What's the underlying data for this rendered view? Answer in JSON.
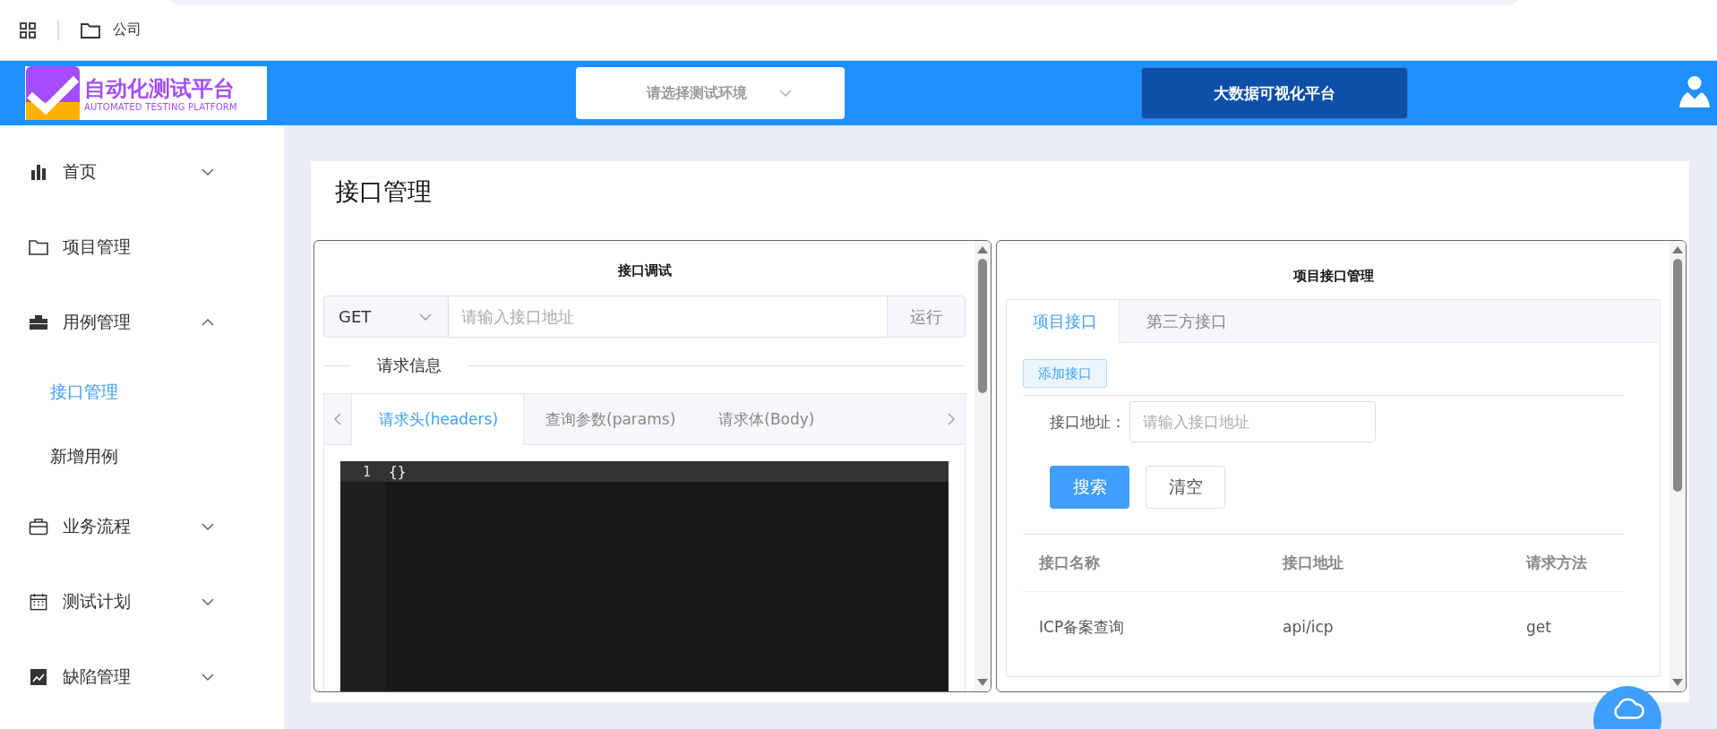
{
  "browser_bar": {
    "breadcrumb": "公司"
  },
  "header": {
    "logo_title": "自动化测试平台",
    "logo_subtitle": "AUTOMATED TESTING PLATFORM",
    "env_select": {
      "placeholder": "请选择测试环境"
    },
    "dashboard_button": "大数据可视化平台"
  },
  "sidebar": {
    "items": [
      {
        "label": "首页",
        "expanded": false
      },
      {
        "label": "项目管理"
      },
      {
        "label": "用例管理",
        "expanded": true,
        "children": [
          {
            "label": "接口管理",
            "selected": true
          },
          {
            "label": "新增用例",
            "selected": false
          }
        ]
      },
      {
        "label": "业务流程",
        "expanded": false
      },
      {
        "label": "测试计划",
        "expanded": false
      },
      {
        "label": "缺陷管理",
        "expanded": false
      }
    ]
  },
  "page_title": "接口管理",
  "debug_panel": {
    "title": "接口调试",
    "method": "GET",
    "url_field": {
      "placeholder": "请输入接口地址"
    },
    "run_button": "运行",
    "section_title": "请求信息",
    "tabs": [
      {
        "label": "请求头(headers)",
        "selected": true
      },
      {
        "label": "查询参数(params)",
        "selected": false
      },
      {
        "label": "请求体(Body)",
        "selected": false
      }
    ],
    "editor": {
      "lines": [
        {
          "number": "1",
          "text": "{}"
        }
      ]
    }
  },
  "api_panel": {
    "title": "项目接口管理",
    "tabs": [
      {
        "label": "项目接口",
        "selected": true
      },
      {
        "label": "第三方接口",
        "selected": false
      }
    ],
    "add_button": "添加接口",
    "filter": {
      "label": "接口地址：",
      "placeholder": "请输入接口地址"
    },
    "search_button": "搜索",
    "clear_button": "清空",
    "table": {
      "columns": [
        "接口名称",
        "接口地址",
        "请求方法"
      ],
      "rows": [
        [
          "ICP备案查询",
          "api/icp",
          "get"
        ]
      ]
    }
  }
}
